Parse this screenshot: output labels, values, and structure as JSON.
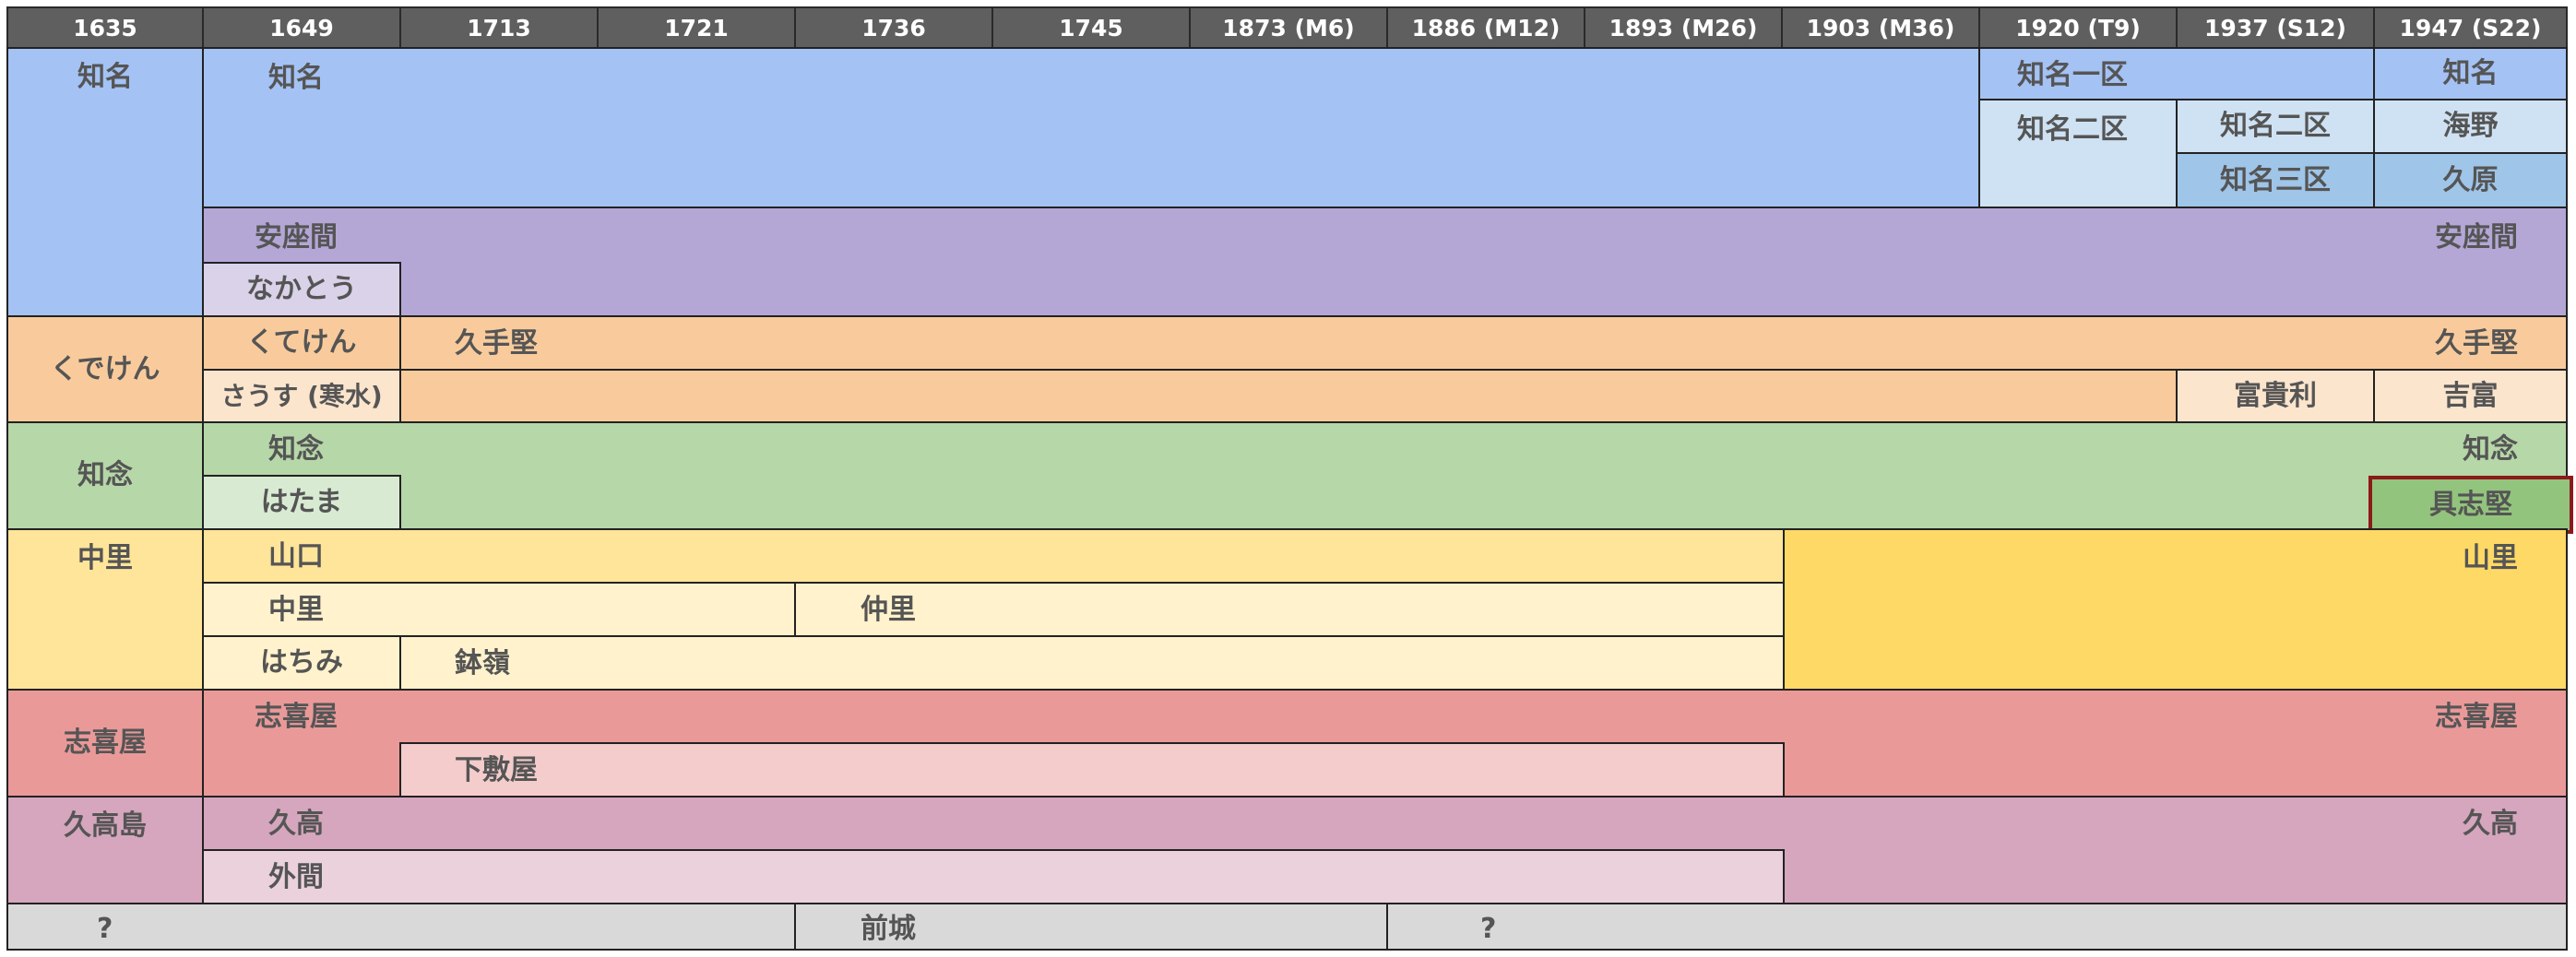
{
  "header": {
    "years": [
      "1635",
      "1649",
      "1713",
      "1721",
      "1736",
      "1745",
      "1873 (M6)",
      "1886 (M12)",
      "1893 (M26)",
      "1903 (M36)",
      "1920 (T9)",
      "1937 (S12)",
      "1947 (S22)"
    ]
  },
  "groups": [
    {
      "name": "知名",
      "color": "#a4c2f4"
    },
    {
      "name": "くでけん",
      "color": "#f9cb9c"
    },
    {
      "name": "知念",
      "color": "#b6d7a8"
    },
    {
      "name": "中里",
      "color": "#ffe599"
    },
    {
      "name": "志喜屋",
      "color": "#ea9999"
    },
    {
      "name": "久高島",
      "color": "#d5a6bd"
    }
  ],
  "cells": {
    "chinen_na": {
      "label": "知名",
      "label_end": "知名"
    },
    "chinen_na_1ku": {
      "label": "知名一区"
    },
    "chinen_na_2ku": {
      "label": "知名二区"
    },
    "chinen_na_2ku_b": {
      "label": "知名二区"
    },
    "chinen_na_3ku": {
      "label": "知名三区"
    },
    "umino": {
      "label": "海野"
    },
    "kubara": {
      "label": "久原"
    },
    "azama": {
      "label": "安座間",
      "label_end": "安座間"
    },
    "nakatou": {
      "label": "なかとう"
    },
    "kuteken": {
      "label": "くてけん"
    },
    "kudeken": {
      "label": "久手堅",
      "label_end": "久手堅"
    },
    "sausu": {
      "label": "さうす (寒水)"
    },
    "fukiri": {
      "label": "富貴利"
    },
    "yoshitomi": {
      "label": "吉富"
    },
    "chinen": {
      "label": "知念",
      "label_end": "知念"
    },
    "hatama": {
      "label": "はたま"
    },
    "gushiken": {
      "label": "具志堅"
    },
    "yamaguchi": {
      "label": "山口"
    },
    "yamazato": {
      "label": "山里"
    },
    "nakazato": {
      "label": "中里"
    },
    "nakazato2": {
      "label": "仲里"
    },
    "hachimi": {
      "label": "はちみ"
    },
    "hachimine": {
      "label": "鉢嶺"
    },
    "shikiya": {
      "label": "志喜屋",
      "label_end": "志喜屋"
    },
    "shimoshikiya": {
      "label": "下敷屋"
    },
    "kudaka": {
      "label": "久高",
      "label_end": "久高"
    },
    "hokama": {
      "label": "外間"
    },
    "unknown1": {
      "label": "?"
    },
    "maegusuku": {
      "label": "前城"
    },
    "unknown2": {
      "label": "?"
    }
  }
}
